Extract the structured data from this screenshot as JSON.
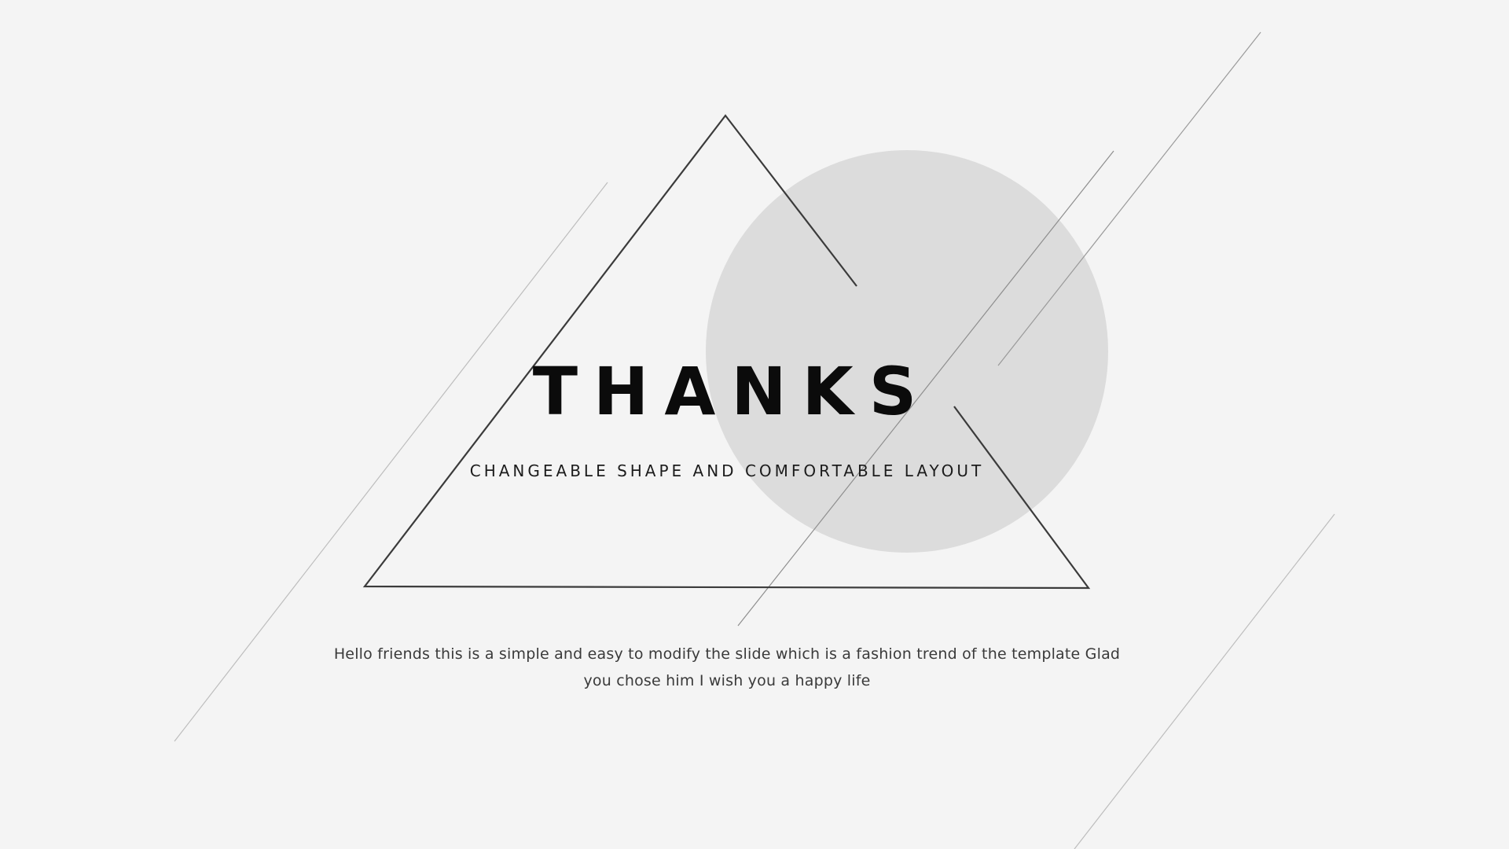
{
  "slide": {
    "title": "THANKS",
    "subtitle": "CHANGEABLE SHAPE AND COMFORTABLE LAYOUT",
    "body": "Hello friends this is a simple and easy to modify the slide which is a fashion trend of the template Glad you chose him I wish you a happy life"
  },
  "colors": {
    "background": "#f4f4f4",
    "circle_fill": "#dcdcdc",
    "triangle_stroke": "#3b3b3b",
    "line_stroke": "#a8a8a8",
    "title_text": "#0b0b0b"
  }
}
